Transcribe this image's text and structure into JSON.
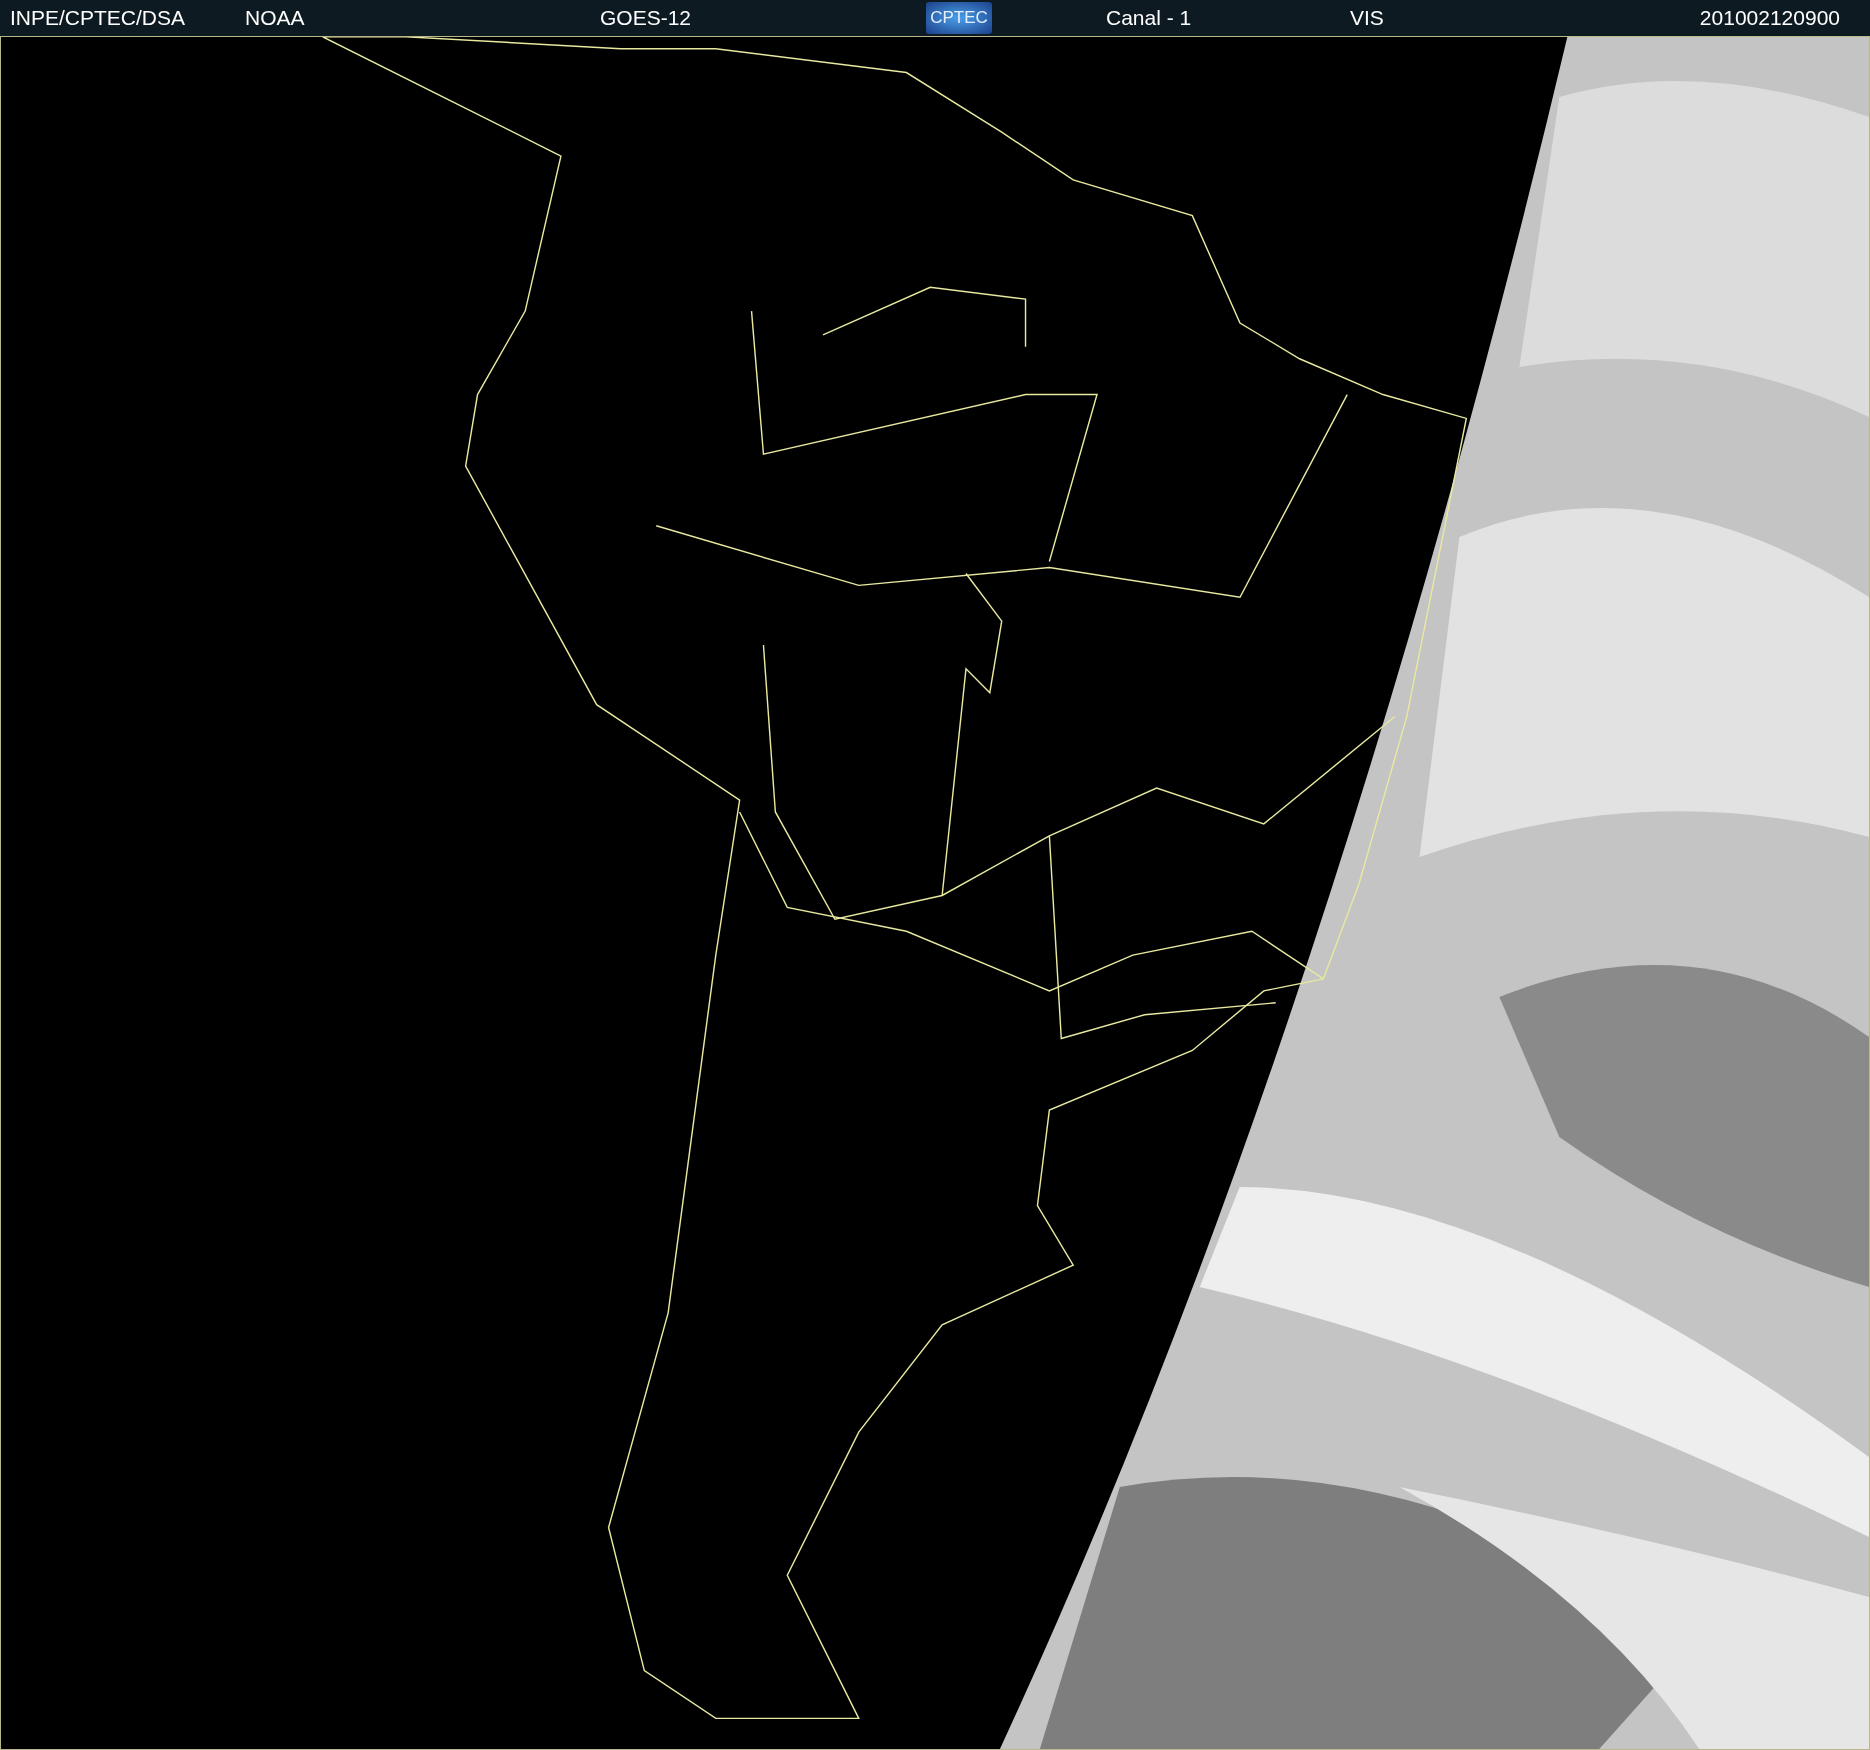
{
  "header": {
    "source": "INPE/CPTEC/DSA",
    "agency": "NOAA",
    "satellite": "GOES-12",
    "logo": "CPTEC",
    "channel": "Canal - 1",
    "band": "VIS",
    "timestamp": "201002120900"
  }
}
